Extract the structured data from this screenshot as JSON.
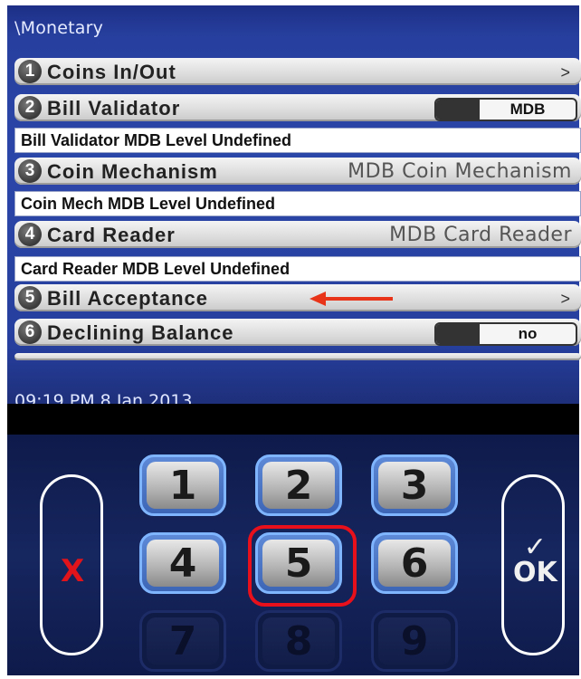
{
  "screen": {
    "title": "\\Monetary",
    "timestamp": "09:19 PM 8 Jan 2013"
  },
  "menu": [
    {
      "num": "1",
      "label": "Coins In/Out",
      "arrow": ">"
    },
    {
      "num": "2",
      "label": "Bill Validator",
      "toggle_value": "MDB"
    },
    {
      "info": "Bill Validator MDB Level Undefined"
    },
    {
      "num": "3",
      "label": "Coin Mechanism",
      "value": "MDB Coin Mechanism"
    },
    {
      "info": "Coin Mech MDB Level Undefined"
    },
    {
      "num": "4",
      "label": "Card Reader",
      "value": "MDB Card Reader"
    },
    {
      "info": "Card Reader MDB Level Undefined"
    },
    {
      "num": "5",
      "label": "Bill Acceptance",
      "arrow": ">"
    },
    {
      "num": "6",
      "label": "Declining Balance",
      "toggle_value": "no"
    }
  ],
  "keypad": {
    "keys": [
      "1",
      "2",
      "3",
      "4",
      "5",
      "6",
      "7",
      "8",
      "9"
    ],
    "highlighted": "5",
    "cancel_glyph": "X",
    "ok_check": "✓",
    "ok_label": "OK"
  },
  "colors": {
    "highlight": "#e8101a",
    "annotation_arrow": "#e8351a",
    "screen_bg": "#2a46a8"
  },
  "icons": {
    "annotation": "left-arrow-icon",
    "cancel": "x-icon",
    "ok": "checkmark-icon"
  }
}
